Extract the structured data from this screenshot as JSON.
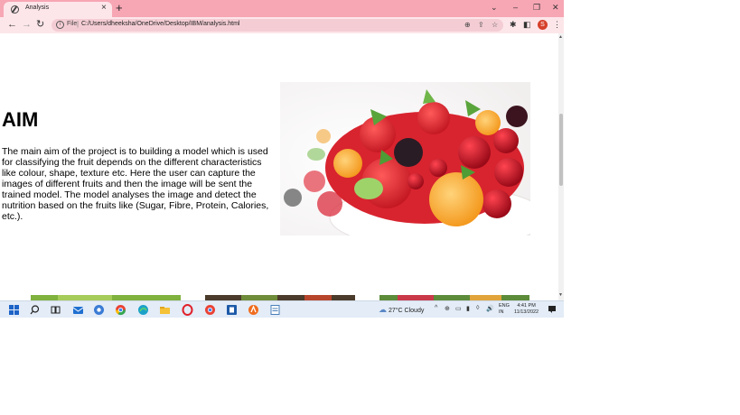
{
  "browser": {
    "tab_title": "Analysis",
    "tab_close": "×",
    "new_tab": "+",
    "window_controls": {
      "tab_search": "⌄",
      "minimize": "–",
      "restore": "❐",
      "close": "✕"
    },
    "nav": {
      "back": "←",
      "forward": "→",
      "reload": "↻"
    },
    "address": {
      "info_icon": "i",
      "scheme_label": "File",
      "separator": "|",
      "url": "C:/Users/dheeksha/OneDrive/Desktop/IBM/analysis.html",
      "zoom_icon": "⊕",
      "share_icon": "⇪",
      "star_icon": "☆"
    },
    "toolbar_icons": {
      "extensions": "✱",
      "sidepanel": "◧",
      "menu": "⋮"
    },
    "profile_initial": "S",
    "colors": {
      "tabstrip": "#f7a6b4",
      "toolbar": "#fde6ea",
      "omnibox": "#f4cdd4",
      "profile": "#d6402b"
    }
  },
  "page": {
    "heading": "AIM",
    "paragraph": "The main aim of the project is to building a model which is used for classifying the fruit depends on the different characteristics like colour, shape, texture etc. Here the user can capture the images of different fruits and then the image will be sent the trained model. The model analyses the image and detect the nutrition based on the fruits like (Sugar, Fibre, Protein, Calories, etc.)."
  },
  "taskbar": {
    "apps": [
      "start",
      "search",
      "task-view",
      "mail",
      "chrome-dev",
      "chrome",
      "edge",
      "file-explorer",
      "opera",
      "chrome-profile",
      "word",
      "avast",
      "notepad"
    ],
    "weather": {
      "temp": "27°C",
      "condition": "Cloudy"
    },
    "tray_icons": [
      "^",
      "⊕",
      "▭",
      "▮",
      "◊",
      "🔊"
    ],
    "language": {
      "line1": "ENG",
      "line2": "IN"
    },
    "clock": {
      "time": "4:41 PM",
      "date": "11/13/2022"
    }
  }
}
